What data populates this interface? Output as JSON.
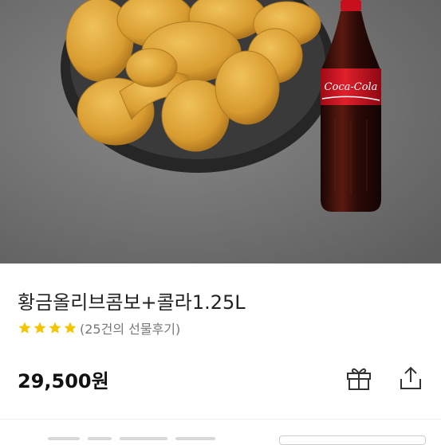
{
  "product": {
    "title": "황금올리브콤보+콜라1.25L",
    "rating_stars": 4,
    "review_text": "(25건의 선물후기)",
    "price_number": "29,500",
    "price_unit": "원"
  },
  "image": {
    "bottle_label": "Coca-Cola",
    "colors": {
      "background": "#6e6e6e",
      "chicken": "#d9a53a",
      "plate": "#2b2b2b",
      "bottle": "#3a0c0a",
      "label": "#c8101c",
      "cap": "#c8101c"
    }
  },
  "icons": {
    "star": "star-icon",
    "gift": "gift-icon",
    "share": "share-icon"
  },
  "colors": {
    "star": "#f5c400",
    "text": "#222222",
    "muted": "#777777"
  }
}
